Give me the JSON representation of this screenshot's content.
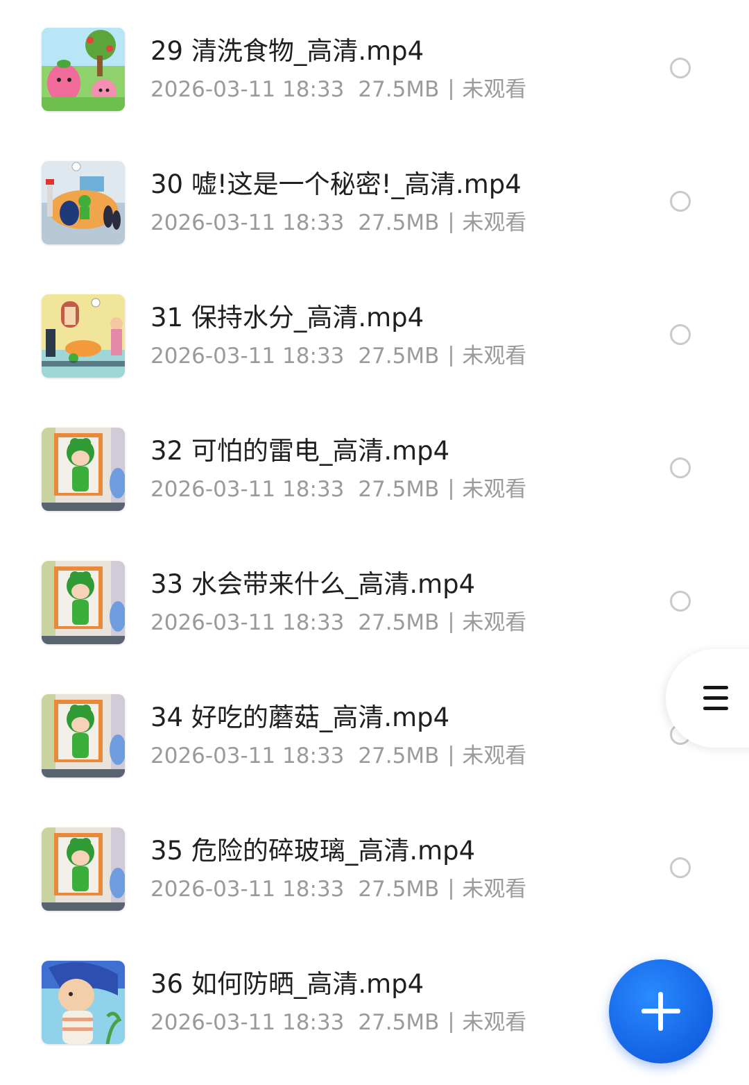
{
  "files": [
    {
      "title": "29 清洗食物_高清.mp4",
      "date": "2026-03-11 18:33",
      "size": "27.5MB",
      "status": "未观看",
      "thumb": "thumb-a"
    },
    {
      "title": "30 嘘!这是一个秘密!_高清.mp4",
      "date": "2026-03-11 18:33",
      "size": "27.5MB",
      "status": "未观看",
      "thumb": "thumb-b"
    },
    {
      "title": "31 保持水分_高清.mp4",
      "date": "2026-03-11 18:33",
      "size": "27.5MB",
      "status": "未观看",
      "thumb": "thumb-c"
    },
    {
      "title": "32 可怕的雷电_高清.mp4",
      "date": "2026-03-11 18:33",
      "size": "27.5MB",
      "status": "未观看",
      "thumb": "thumb-d"
    },
    {
      "title": "33 水会带来什么_高清.mp4",
      "date": "2026-03-11 18:33",
      "size": "27.5MB",
      "status": "未观看",
      "thumb": "thumb-d"
    },
    {
      "title": "34 好吃的蘑菇_高清.mp4",
      "date": "2026-03-11 18:33",
      "size": "27.5MB",
      "status": "未观看",
      "thumb": "thumb-d"
    },
    {
      "title": "35 危险的碎玻璃_高清.mp4",
      "date": "2026-03-11 18:33",
      "size": "27.5MB",
      "status": "未观看",
      "thumb": "thumb-d"
    },
    {
      "title": "36 如何防晒_高清.mp4",
      "date": "2026-03-11 18:33",
      "size": "27.5MB",
      "status": "未观看",
      "thumb": "thumb-e"
    }
  ],
  "icons": {
    "drawer": "menu-icon",
    "fab": "plus-icon",
    "select": "radio-circle-icon"
  },
  "colors": {
    "fab": "#1565e6",
    "title_text": "#1f1f1f",
    "meta_text": "#9a9a9a",
    "radio_border": "#c9c9c9"
  }
}
